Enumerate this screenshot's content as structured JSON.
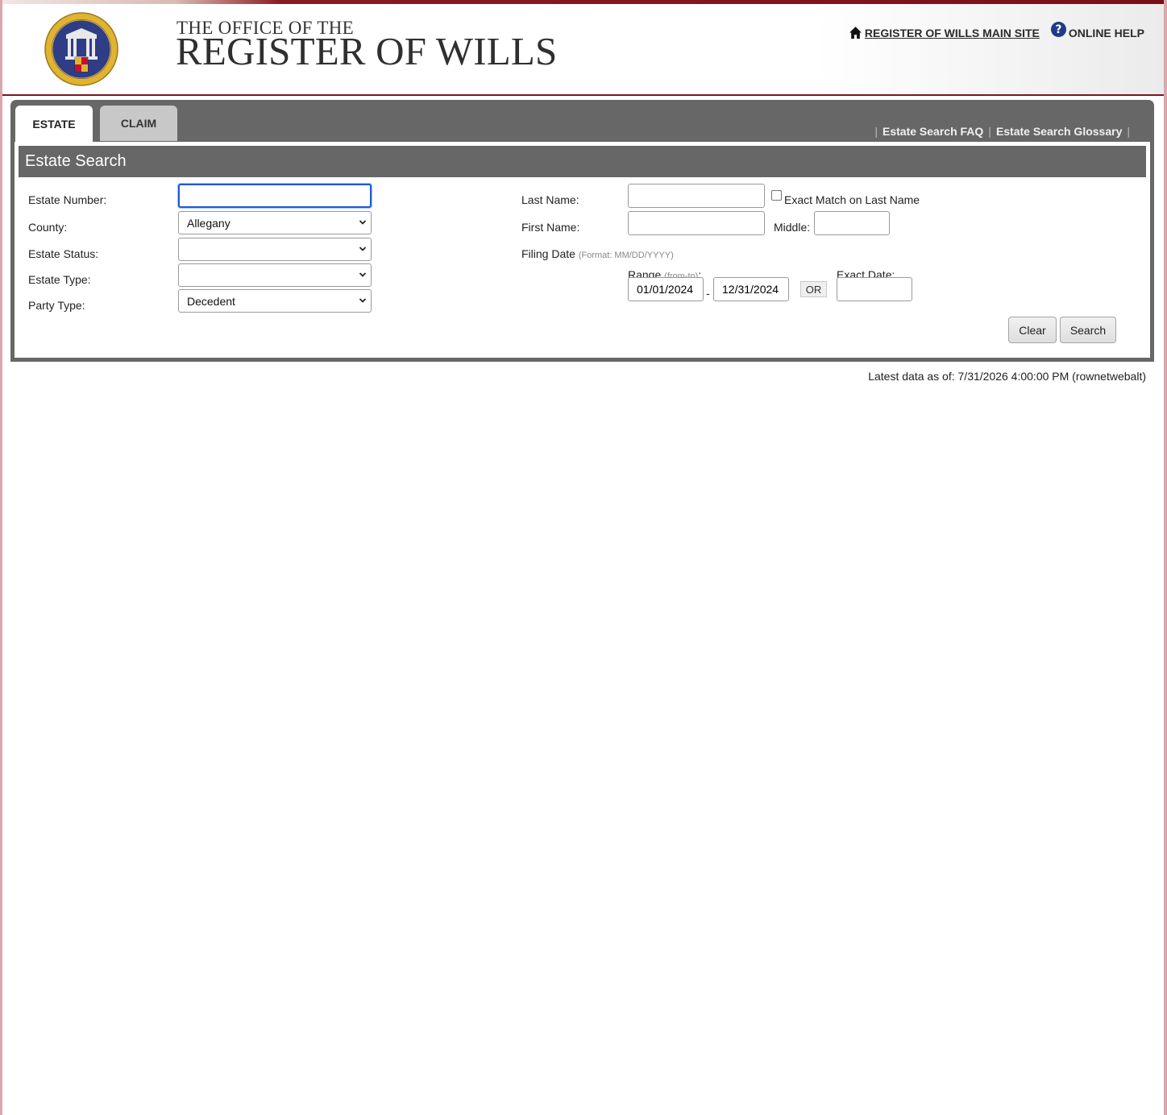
{
  "header": {
    "office_line": "THE OFFICE OF THE",
    "title": "REGISTER OF WILLS",
    "main_site_link": "REGISTER OF WILLS MAIN SITE",
    "help_link": "ONLINE HELP",
    "help_glyph": "?",
    "seal_icon": "maryland-register-of-wills-seal"
  },
  "tabs": [
    {
      "label": "ESTATE",
      "active": true
    },
    {
      "label": "CLAIM",
      "active": false
    }
  ],
  "panel_links": {
    "faq": "Estate Search FAQ",
    "glossary": "Estate Search Glossary",
    "separator": "|"
  },
  "section_title": "Estate Search",
  "form": {
    "estate_number_label": "Estate Number:",
    "estate_number_value": "",
    "county_label": "County:",
    "county_value": "Allegany",
    "estate_status_label": "Estate Status:",
    "estate_status_value": "",
    "estate_type_label": "Estate Type:",
    "estate_type_value": "",
    "party_type_label": "Party Type:",
    "party_type_value": "Decedent",
    "last_name_label": "Last Name:",
    "last_name_value": "",
    "exact_match_label": "Exact Match on Last Name",
    "exact_match_checked": false,
    "first_name_label": "First Name:",
    "first_name_value": "",
    "middle_label": "Middle:",
    "middle_value": "",
    "filing_date_label": "Filing Date",
    "filing_date_format": "(Format: MM/DD/YYYY)",
    "range_label": "Range",
    "range_note": "(from-to)",
    "range_colon": ":",
    "range_from": "01/01/2024",
    "range_dash": "-",
    "range_to": "12/31/2024",
    "or_label": "OR",
    "exact_date_label": "Exact Date:",
    "exact_date_value": "",
    "clear_button": "Clear",
    "search_button": "Search"
  },
  "footer": {
    "latest_data": "Latest data as of: 7/31/2026 4:00:00 PM (rownetwebalt)"
  },
  "colors": {
    "panel_gray": "#676767",
    "accent_maroon": "#7a1520",
    "focus_blue": "#1d5bd6",
    "help_blue": "#1f3a8a"
  }
}
